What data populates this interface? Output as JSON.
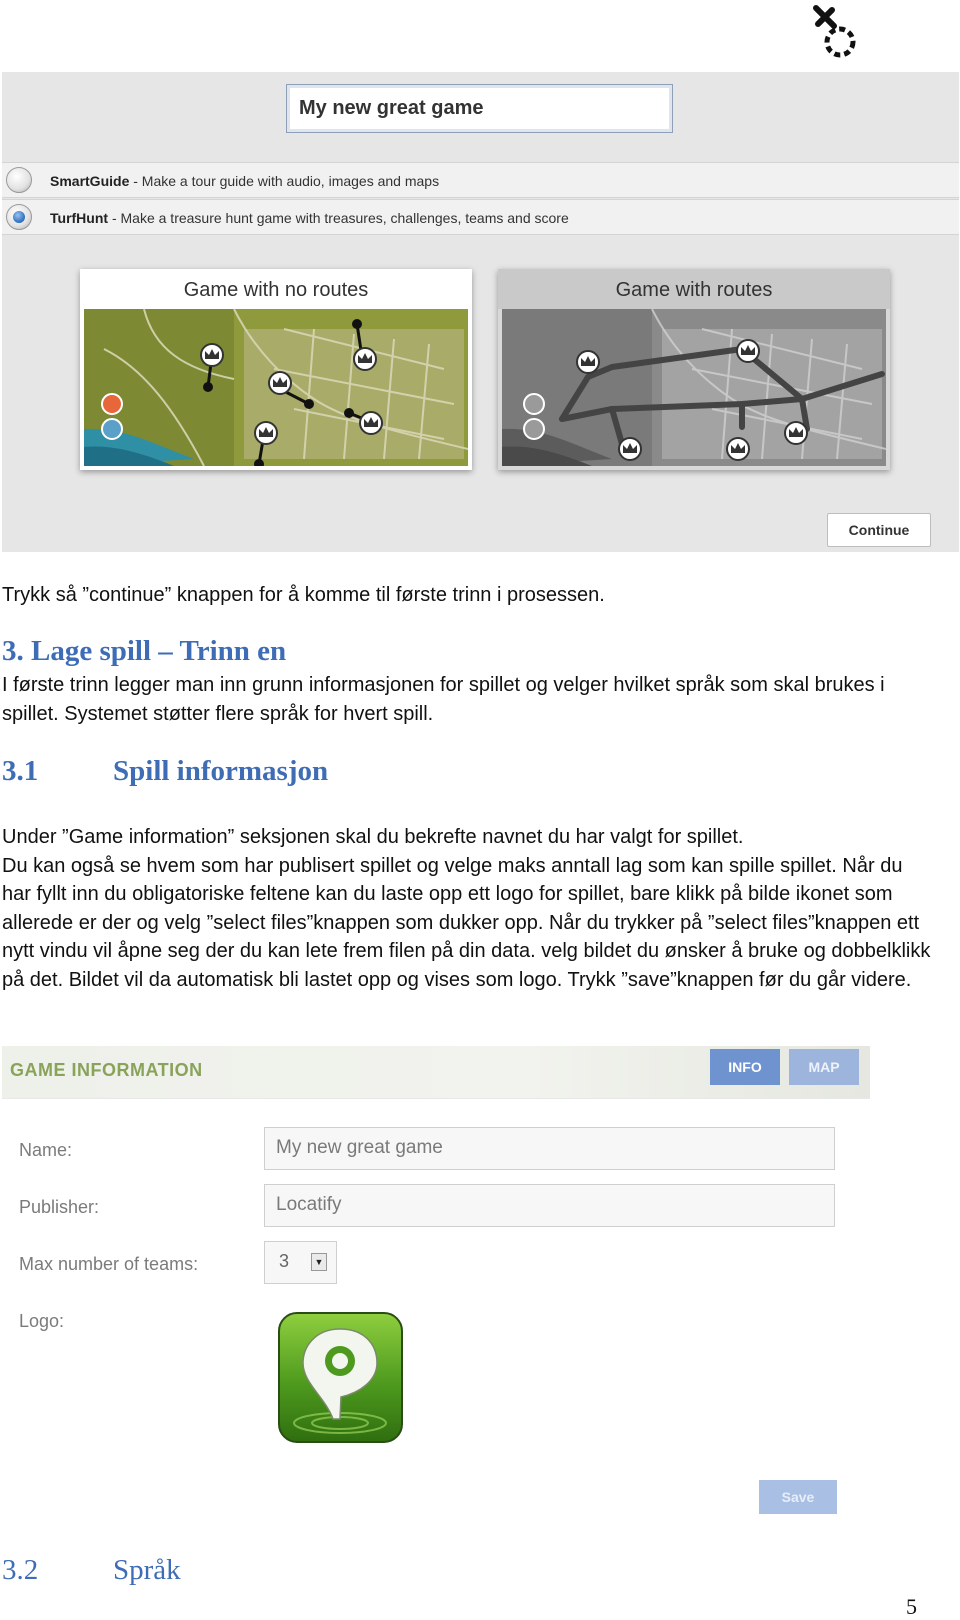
{
  "screenshot1": {
    "game_title": "My new great game",
    "options": [
      {
        "name": "SmartGuide",
        "desc": " - Make a tour guide with audio, images and maps",
        "selected": false
      },
      {
        "name": "TurfHunt",
        "desc": " - Make a treasure hunt game with treasures, challenges, teams and score",
        "selected": true
      }
    ],
    "cards": {
      "no_routes": "Game with no routes",
      "routes": "Game with routes"
    },
    "continue_label": "Continue"
  },
  "text": {
    "p_continue": "Trykk så ”continue” knappen for å komme til første trinn i prosessen.",
    "h3_num": "3.",
    "h3_title": "Lage spill – Trinn en",
    "p_intro": "I første trinn legger man inn grunn informasjonen for spillet og velger hvilket språk som skal brukes i spillet. Systemet støtter flere språk for hvert spill.",
    "h31_num": "3.1",
    "h31_title": "Spill informasjon",
    "p_game_1": "Under ”Game information” seksjonen skal du bekrefte navnet du har valgt for spillet.",
    "p_game_2": "Du kan også se hvem som har publisert spillet og velge maks anntall lag som kan spille spillet. Når du har fyllt inn du obligatoriske feltene kan du laste opp ett logo for spillet, bare klikk på bilde ikonet som allerede er der og velg ”select files”knappen som dukker opp. Når du trykker på ”select files”knappen ett nytt vindu vil åpne seg der du kan lete frem filen på din data. velg bildet du ønsker å bruke og dobbelklikk på det. Bildet vil da automatisk bli lastet opp og vises som logo. Trykk ”save”knappen før du går videre.",
    "h32_num": "3.2",
    "h32_title": "Språk",
    "page_number": "5"
  },
  "game_info": {
    "title": "GAME INFORMATION",
    "tabs": {
      "info": "INFO",
      "map": "MAP"
    },
    "name_label": "Name:",
    "name_value": "My new great game",
    "publisher_label": "Publisher:",
    "publisher_value": "Locatify",
    "teams_label": "Max number of teams:",
    "teams_value": "3",
    "logo_label": "Logo:",
    "save_label": "Save"
  },
  "colors": {
    "heading_blue": "#3e6db5",
    "panel_title_green": "#8aa35a",
    "tab_info": "#6f93cf",
    "tab_map": "#9db4dc",
    "save_button": "#a9bfe3",
    "map_green": "#8f9a3c",
    "map_gray": "#8a8a8a"
  },
  "icons": [
    "logo-mark-icon",
    "radio-icon",
    "runner-icon",
    "crown-marker-icon",
    "location-pin-logo-icon",
    "dropdown-arrow-icon"
  ]
}
